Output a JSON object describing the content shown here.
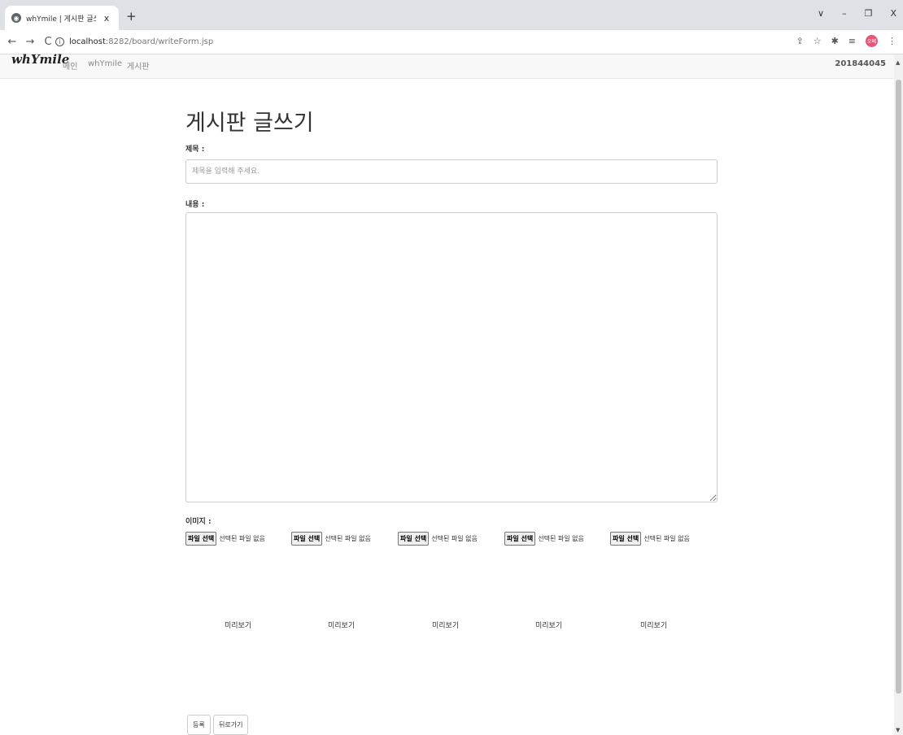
{
  "browser": {
    "tab_title": "whYmile | 게시판 글쓰기",
    "tab_close": "x",
    "new_tab": "+",
    "url_host": "localhost",
    "url_path": ":8282/board/writeForm.jsp",
    "profile_label": "오페"
  },
  "navbar": {
    "brand": "whYmile",
    "links": [
      "메인",
      "whYmile",
      "게시판"
    ],
    "user": "201844045"
  },
  "form": {
    "heading": "게시판 글쓰기",
    "title_label": "제목 :",
    "title_placeholder": "제목을 입력해 주세요.",
    "content_label": "내용 :",
    "image_label": "이미지 :",
    "file_inputs": [
      {
        "button": "파일 선택",
        "status": "선택된 파일 없음"
      },
      {
        "button": "파일 선택",
        "status": "선택된 파일 없음"
      },
      {
        "button": "파일 선택",
        "status": "선택된 파일 없음"
      },
      {
        "button": "파일 선택",
        "status": "선택된 파일 없음"
      },
      {
        "button": "파일 선택",
        "status": "선택된 파일 없음"
      }
    ],
    "previews": [
      "미리보기",
      "미리보기",
      "미리보기",
      "미리보기",
      "미리보기"
    ],
    "submit_label": "등록",
    "back_label": "뒤로가기"
  },
  "icons": [
    "globe-icon",
    "back-arrow-icon",
    "forward-arrow-icon",
    "reload-icon",
    "info-icon",
    "share-icon",
    "star-icon",
    "extensions-icon",
    "reading-list-icon",
    "menu-icon"
  ]
}
